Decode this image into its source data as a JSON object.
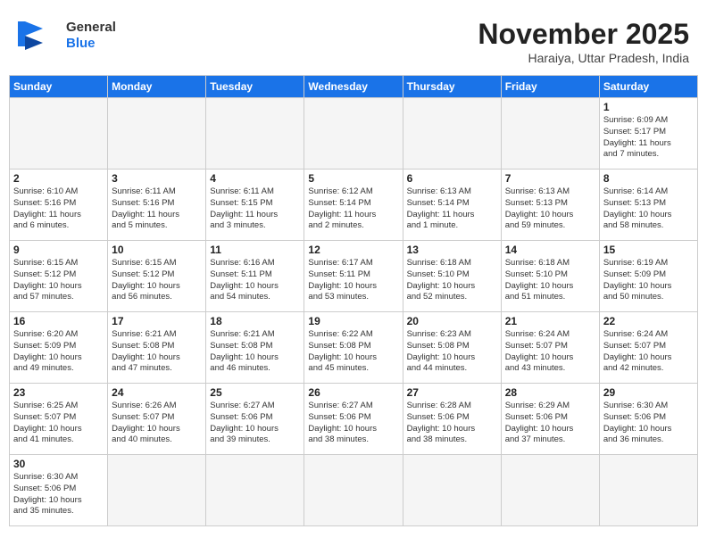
{
  "header": {
    "logo_general": "General",
    "logo_blue": "Blue",
    "month": "November 2025",
    "location": "Haraiya, Uttar Pradesh, India"
  },
  "weekdays": [
    "Sunday",
    "Monday",
    "Tuesday",
    "Wednesday",
    "Thursday",
    "Friday",
    "Saturday"
  ],
  "weeks": [
    [
      {
        "day": "",
        "info": ""
      },
      {
        "day": "",
        "info": ""
      },
      {
        "day": "",
        "info": ""
      },
      {
        "day": "",
        "info": ""
      },
      {
        "day": "",
        "info": ""
      },
      {
        "day": "",
        "info": ""
      },
      {
        "day": "1",
        "info": "Sunrise: 6:09 AM\nSunset: 5:17 PM\nDaylight: 11 hours\nand 7 minutes."
      }
    ],
    [
      {
        "day": "2",
        "info": "Sunrise: 6:10 AM\nSunset: 5:16 PM\nDaylight: 11 hours\nand 6 minutes."
      },
      {
        "day": "3",
        "info": "Sunrise: 6:11 AM\nSunset: 5:16 PM\nDaylight: 11 hours\nand 5 minutes."
      },
      {
        "day": "4",
        "info": "Sunrise: 6:11 AM\nSunset: 5:15 PM\nDaylight: 11 hours\nand 3 minutes."
      },
      {
        "day": "5",
        "info": "Sunrise: 6:12 AM\nSunset: 5:14 PM\nDaylight: 11 hours\nand 2 minutes."
      },
      {
        "day": "6",
        "info": "Sunrise: 6:13 AM\nSunset: 5:14 PM\nDaylight: 11 hours\nand 1 minute."
      },
      {
        "day": "7",
        "info": "Sunrise: 6:13 AM\nSunset: 5:13 PM\nDaylight: 10 hours\nand 59 minutes."
      },
      {
        "day": "8",
        "info": "Sunrise: 6:14 AM\nSunset: 5:13 PM\nDaylight: 10 hours\nand 58 minutes."
      }
    ],
    [
      {
        "day": "9",
        "info": "Sunrise: 6:15 AM\nSunset: 5:12 PM\nDaylight: 10 hours\nand 57 minutes."
      },
      {
        "day": "10",
        "info": "Sunrise: 6:15 AM\nSunset: 5:12 PM\nDaylight: 10 hours\nand 56 minutes."
      },
      {
        "day": "11",
        "info": "Sunrise: 6:16 AM\nSunset: 5:11 PM\nDaylight: 10 hours\nand 54 minutes."
      },
      {
        "day": "12",
        "info": "Sunrise: 6:17 AM\nSunset: 5:11 PM\nDaylight: 10 hours\nand 53 minutes."
      },
      {
        "day": "13",
        "info": "Sunrise: 6:18 AM\nSunset: 5:10 PM\nDaylight: 10 hours\nand 52 minutes."
      },
      {
        "day": "14",
        "info": "Sunrise: 6:18 AM\nSunset: 5:10 PM\nDaylight: 10 hours\nand 51 minutes."
      },
      {
        "day": "15",
        "info": "Sunrise: 6:19 AM\nSunset: 5:09 PM\nDaylight: 10 hours\nand 50 minutes."
      }
    ],
    [
      {
        "day": "16",
        "info": "Sunrise: 6:20 AM\nSunset: 5:09 PM\nDaylight: 10 hours\nand 49 minutes."
      },
      {
        "day": "17",
        "info": "Sunrise: 6:21 AM\nSunset: 5:08 PM\nDaylight: 10 hours\nand 47 minutes."
      },
      {
        "day": "18",
        "info": "Sunrise: 6:21 AM\nSunset: 5:08 PM\nDaylight: 10 hours\nand 46 minutes."
      },
      {
        "day": "19",
        "info": "Sunrise: 6:22 AM\nSunset: 5:08 PM\nDaylight: 10 hours\nand 45 minutes."
      },
      {
        "day": "20",
        "info": "Sunrise: 6:23 AM\nSunset: 5:08 PM\nDaylight: 10 hours\nand 44 minutes."
      },
      {
        "day": "21",
        "info": "Sunrise: 6:24 AM\nSunset: 5:07 PM\nDaylight: 10 hours\nand 43 minutes."
      },
      {
        "day": "22",
        "info": "Sunrise: 6:24 AM\nSunset: 5:07 PM\nDaylight: 10 hours\nand 42 minutes."
      }
    ],
    [
      {
        "day": "23",
        "info": "Sunrise: 6:25 AM\nSunset: 5:07 PM\nDaylight: 10 hours\nand 41 minutes."
      },
      {
        "day": "24",
        "info": "Sunrise: 6:26 AM\nSunset: 5:07 PM\nDaylight: 10 hours\nand 40 minutes."
      },
      {
        "day": "25",
        "info": "Sunrise: 6:27 AM\nSunset: 5:06 PM\nDaylight: 10 hours\nand 39 minutes."
      },
      {
        "day": "26",
        "info": "Sunrise: 6:27 AM\nSunset: 5:06 PM\nDaylight: 10 hours\nand 38 minutes."
      },
      {
        "day": "27",
        "info": "Sunrise: 6:28 AM\nSunset: 5:06 PM\nDaylight: 10 hours\nand 38 minutes."
      },
      {
        "day": "28",
        "info": "Sunrise: 6:29 AM\nSunset: 5:06 PM\nDaylight: 10 hours\nand 37 minutes."
      },
      {
        "day": "29",
        "info": "Sunrise: 6:30 AM\nSunset: 5:06 PM\nDaylight: 10 hours\nand 36 minutes."
      }
    ],
    [
      {
        "day": "30",
        "info": "Sunrise: 6:30 AM\nSunset: 5:06 PM\nDaylight: 10 hours\nand 35 minutes."
      },
      {
        "day": "",
        "info": ""
      },
      {
        "day": "",
        "info": ""
      },
      {
        "day": "",
        "info": ""
      },
      {
        "day": "",
        "info": ""
      },
      {
        "day": "",
        "info": ""
      },
      {
        "day": "",
        "info": ""
      }
    ]
  ]
}
